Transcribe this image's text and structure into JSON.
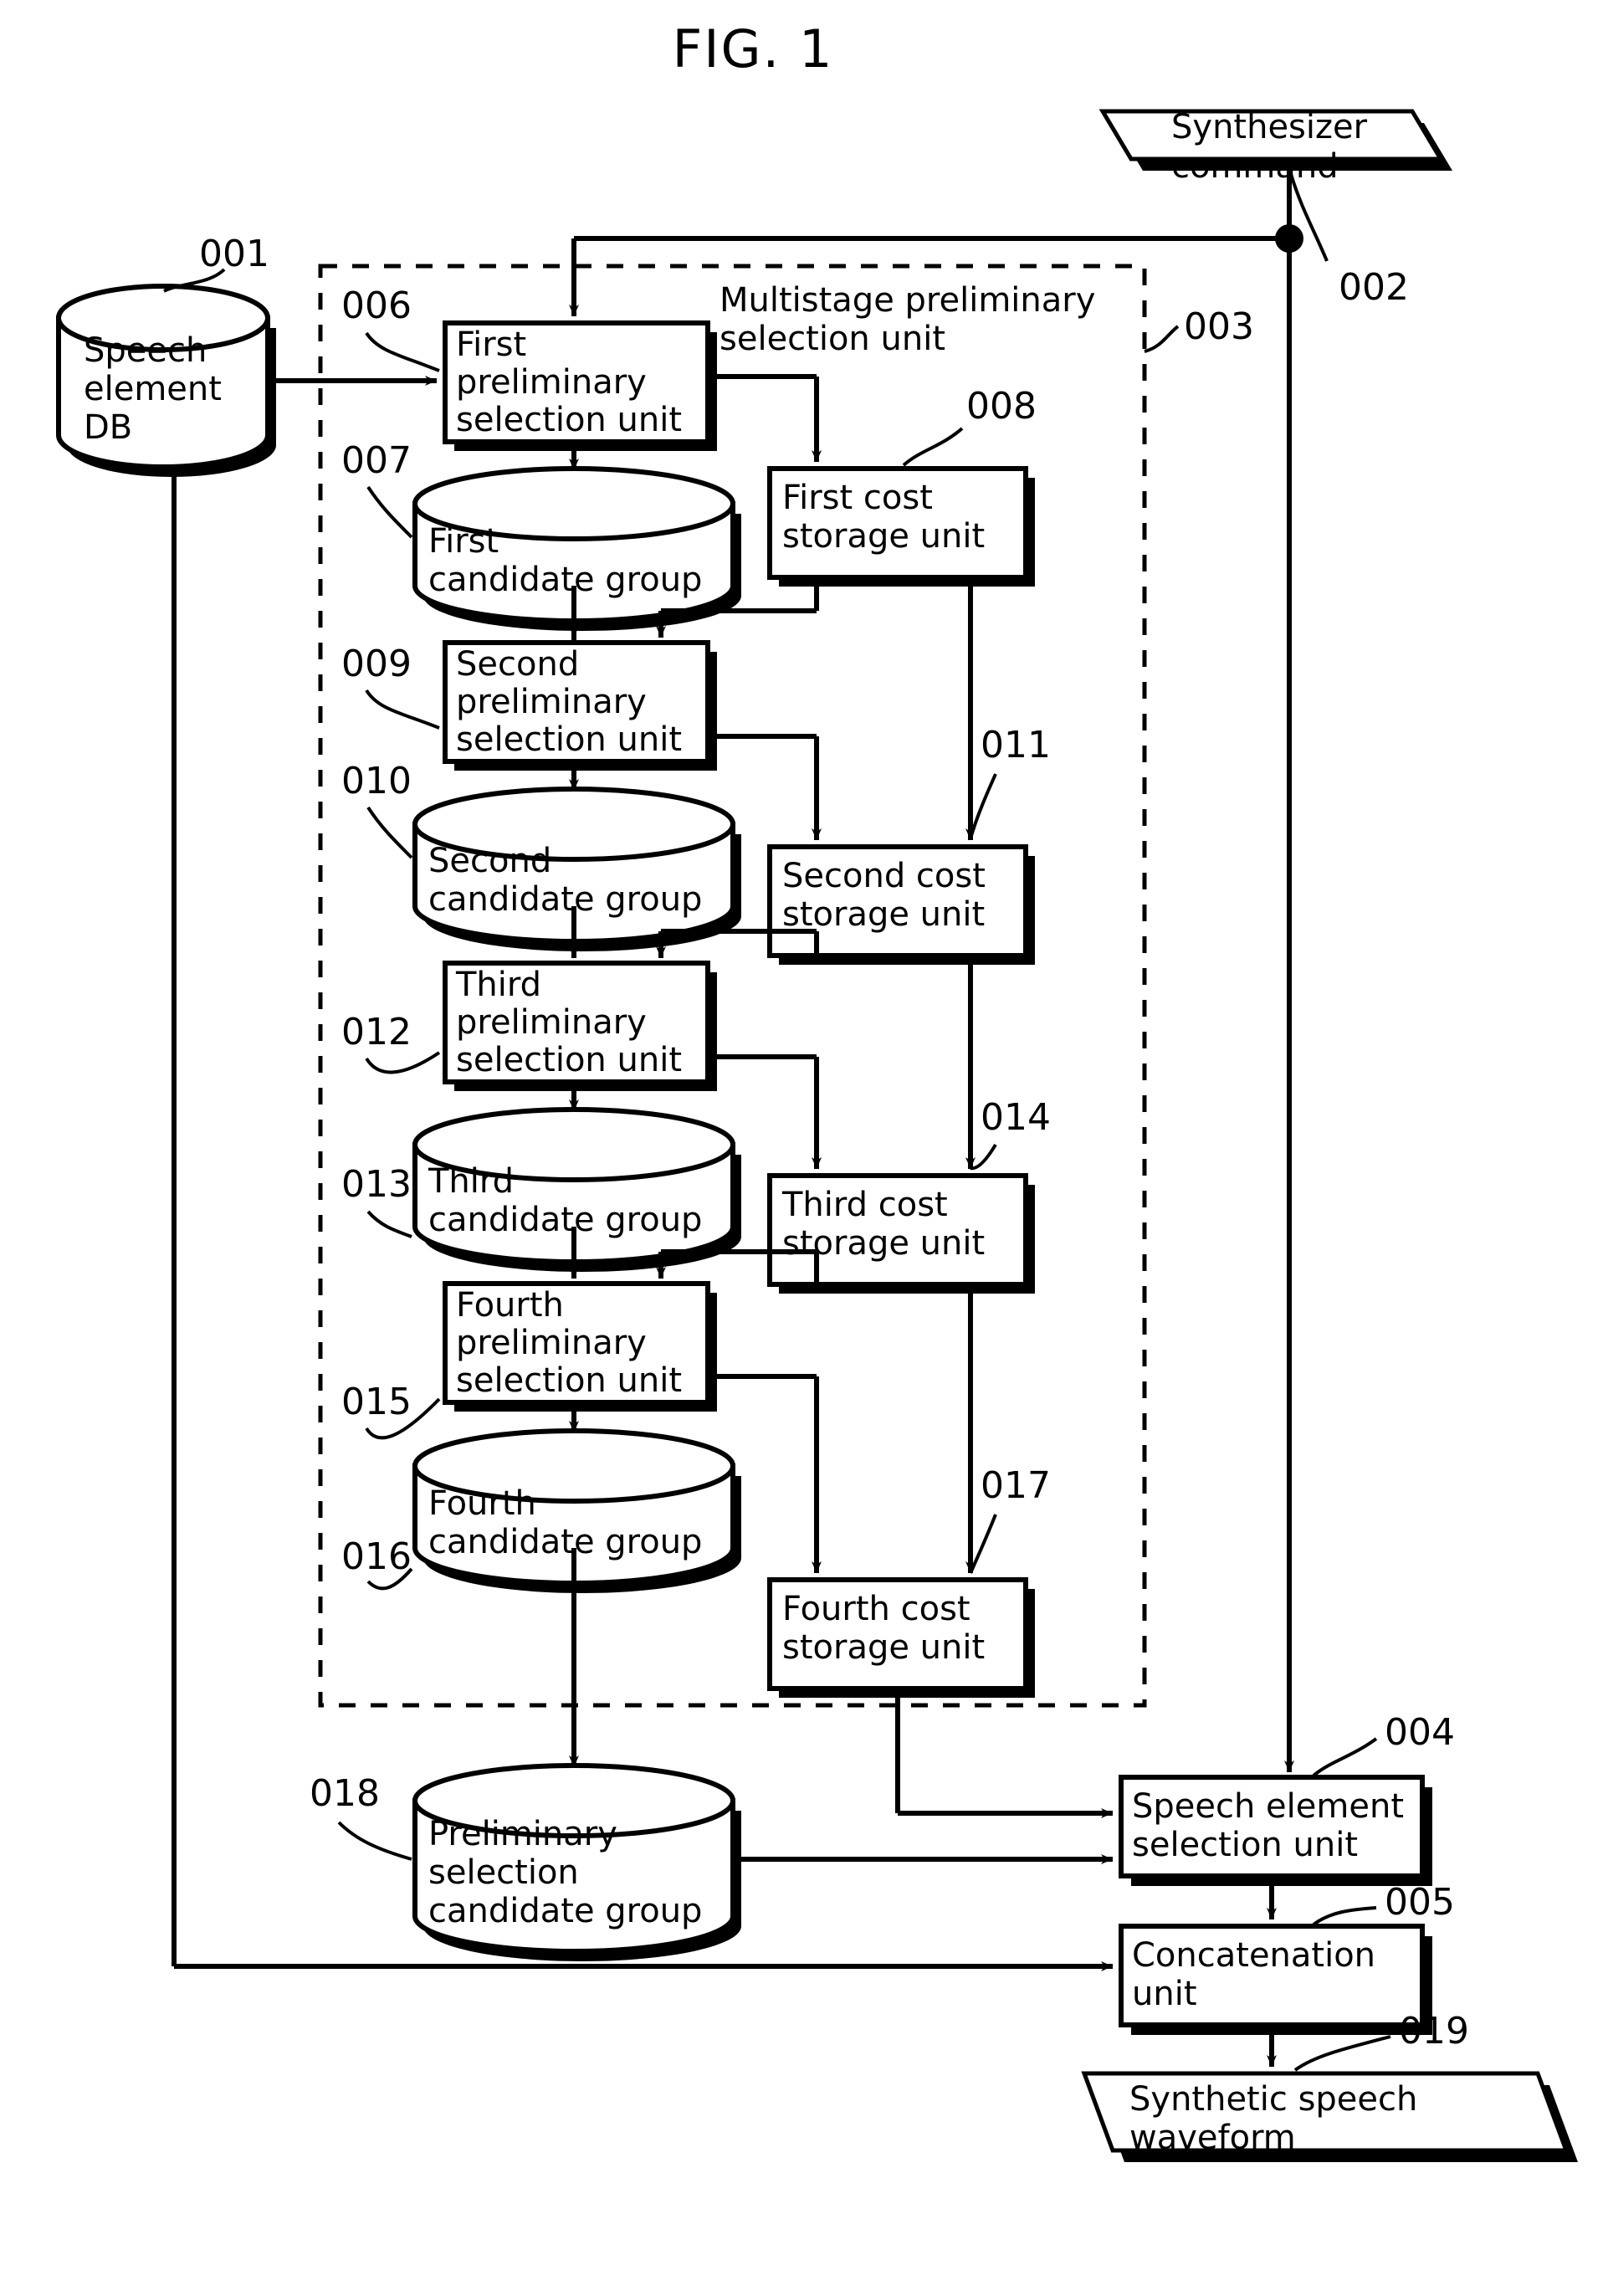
{
  "figure": {
    "title": "FIG. 1",
    "group_label_line1": "Multistage preliminary",
    "group_label_line2": "selection unit"
  },
  "nodes": {
    "speech_element_db": {
      "ref": "001",
      "line1": "Speech",
      "line2": "element",
      "line3": "DB",
      "shape": "cylinder"
    },
    "synthesizer_command": {
      "ref": "002",
      "line1": "Synthesizer",
      "line2": "command",
      "shape": "parallelogram"
    },
    "multistage_unit": {
      "ref": "003",
      "shape": "dashed-box"
    },
    "speech_element_selection_unit": {
      "ref": "004",
      "line1": "Speech element",
      "line2": "selection unit",
      "shape": "box"
    },
    "concatenation_unit": {
      "ref": "005",
      "line1": "Concatenation",
      "line2": "unit",
      "shape": "box"
    },
    "first_preliminary_selection_unit": {
      "ref": "006",
      "line1": "First",
      "line2": "preliminary",
      "line3": "selection unit",
      "shape": "box"
    },
    "first_candidate_group": {
      "ref": "007",
      "line1": "First",
      "line2": "candidate group",
      "shape": "cylinder"
    },
    "first_cost_storage_unit": {
      "ref": "008",
      "line1": "First cost",
      "line2": "storage unit",
      "shape": "box"
    },
    "second_preliminary_selection_unit": {
      "ref": "009",
      "line1": "Second",
      "line2": "preliminary",
      "line3": "selection unit",
      "shape": "box"
    },
    "second_candidate_group": {
      "ref": "010",
      "line1": "Second",
      "line2": "candidate group",
      "shape": "cylinder"
    },
    "second_cost_storage_unit": {
      "ref": "011",
      "line1": "Second cost",
      "line2": "storage unit",
      "shape": "box"
    },
    "third_preliminary_selection_unit": {
      "ref": "012",
      "line1": "Third",
      "line2": "preliminary",
      "line3": "selection unit",
      "shape": "box"
    },
    "third_candidate_group": {
      "ref": "013",
      "line1": "Third",
      "line2": "candidate group",
      "shape": "cylinder"
    },
    "third_cost_storage_unit": {
      "ref": "014",
      "line1": "Third cost",
      "line2": "storage unit",
      "shape": "box"
    },
    "fourth_preliminary_selection_unit": {
      "ref": "015",
      "line1": "Fourth",
      "line2": "preliminary",
      "line3": "selection unit",
      "shape": "box"
    },
    "fourth_candidate_group": {
      "ref": "016",
      "line1": "Fourth",
      "line2": "candidate group",
      "shape": "cylinder"
    },
    "fourth_cost_storage_unit": {
      "ref": "017",
      "line1": "Fourth cost",
      "line2": "storage unit",
      "shape": "box"
    },
    "preliminary_selection_candidate_group": {
      "ref": "018",
      "line1": "Preliminary",
      "line2": "selection",
      "line3": "candidate group",
      "shape": "cylinder"
    },
    "synthetic_speech_waveform": {
      "ref": "019",
      "line1": "Synthetic speech",
      "line2": "waveform",
      "shape": "parallelogram"
    }
  },
  "colors": {
    "stroke": "#000000",
    "fill": "#ffffff",
    "shadow": "#000000"
  }
}
